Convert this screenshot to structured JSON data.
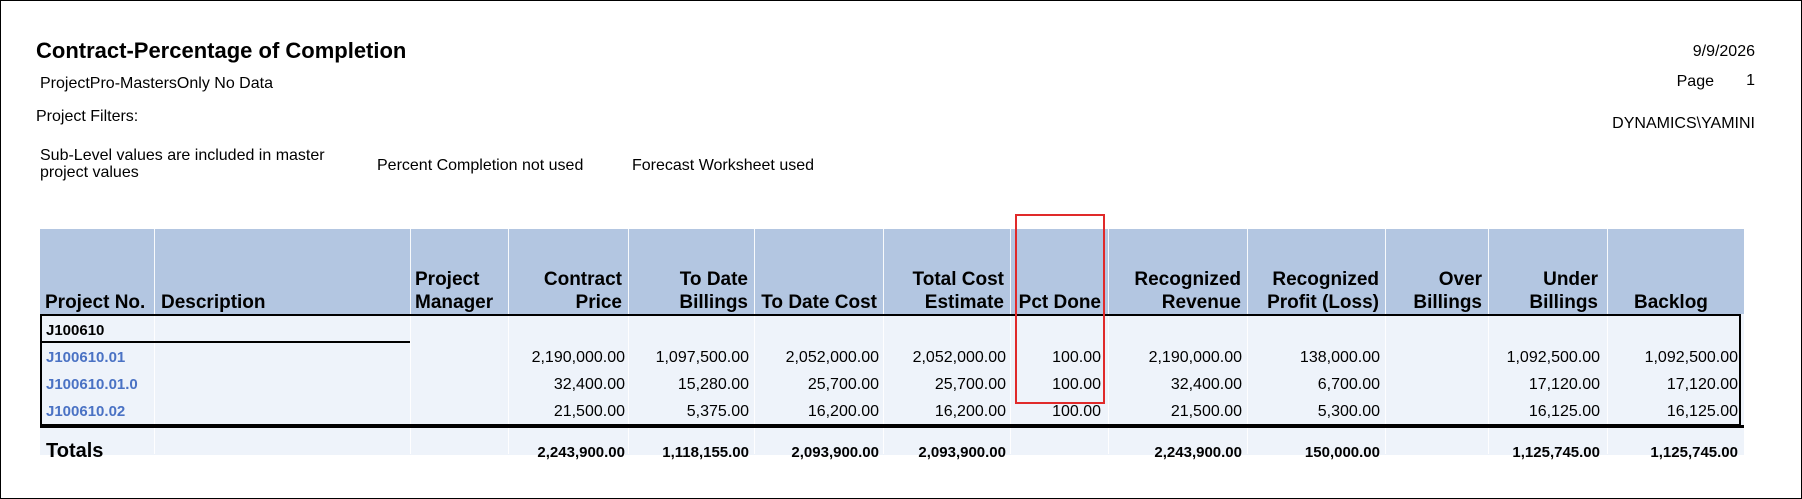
{
  "report": {
    "title": "Contract-Percentage of Completion",
    "subtitle": "ProjectPro-MastersOnly No Data",
    "filters_label": "Project Filters:",
    "note_sublevel": "Sub-Level values are included in master project values",
    "note_percent": "Percent Completion not used",
    "note_forecast": "Forecast Worksheet used",
    "date": "9/9/2026",
    "page_label": "Page",
    "page_number": "1",
    "user": "DYNAMICS\\YAMINI"
  },
  "table": {
    "headers": {
      "project_no": "Project No.",
      "description": "Description",
      "project_manager": "Project Manager",
      "contract_price": "Contract Price",
      "to_date_billings": "To Date Billings",
      "to_date_cost": "To Date Cost",
      "total_cost_estimate": "Total Cost Estimate",
      "pct_done": "Pct Done",
      "recognized_revenue": "Recognized Revenue",
      "recognized_profit": "Recognized Profit (Loss)",
      "over_billings": "Over Billings",
      "under_billings": "Under Billings",
      "backlog": "Backlog"
    },
    "group": "J100610",
    "rows": [
      {
        "project_no": "J100610.01",
        "contract_price": "2,190,000.00",
        "to_date_billings": "1,097,500.00",
        "to_date_cost": "2,052,000.00",
        "total_cost_estimate": "2,052,000.00",
        "pct_done": "100.00",
        "recognized_revenue": "2,190,000.00",
        "recognized_profit": "138,000.00",
        "over_billings": "",
        "under_billings": "1,092,500.00",
        "backlog": "1,092,500.00"
      },
      {
        "project_no": "J100610.01.0",
        "contract_price": "32,400.00",
        "to_date_billings": "15,280.00",
        "to_date_cost": "25,700.00",
        "total_cost_estimate": "25,700.00",
        "pct_done": "100.00",
        "recognized_revenue": "32,400.00",
        "recognized_profit": "6,700.00",
        "over_billings": "",
        "under_billings": "17,120.00",
        "backlog": "17,120.00"
      },
      {
        "project_no": "J100610.02",
        "contract_price": "21,500.00",
        "to_date_billings": "5,375.00",
        "to_date_cost": "16,200.00",
        "total_cost_estimate": "16,200.00",
        "pct_done": "100.00",
        "recognized_revenue": "21,500.00",
        "recognized_profit": "5,300.00",
        "over_billings": "",
        "under_billings": "16,125.00",
        "backlog": "16,125.00"
      }
    ],
    "totals": {
      "label": "Totals",
      "contract_price": "2,243,900.00",
      "to_date_billings": "1,118,155.00",
      "to_date_cost": "2,093,900.00",
      "total_cost_estimate": "2,093,900.00",
      "recognized_revenue": "2,243,900.00",
      "recognized_profit": "150,000.00",
      "under_billings": "1,125,745.00",
      "backlog": "1,125,745.00"
    }
  },
  "colors": {
    "header_bg": "#b3c6e1",
    "body_bg": "#eef3fa",
    "link": "#4a72c4",
    "highlight": "#e02a2a"
  }
}
